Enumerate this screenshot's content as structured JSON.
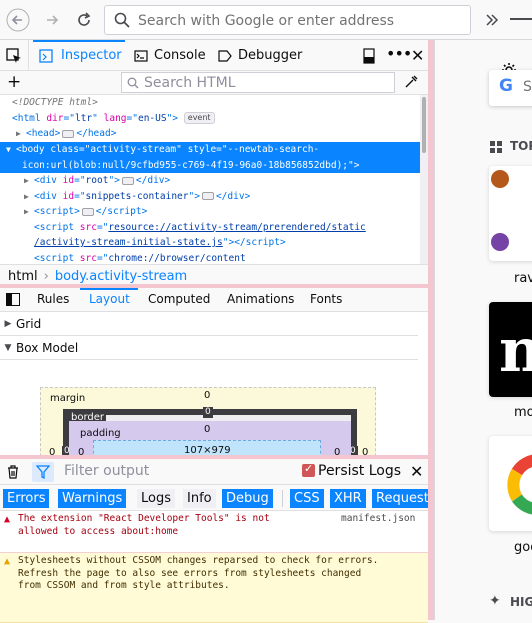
{
  "browser": {
    "url_placeholder": "Search with Google or enter address"
  },
  "devtools": {
    "tabs": [
      {
        "label": "Inspector",
        "selected": true
      },
      {
        "label": "Console",
        "selected": false
      },
      {
        "label": "Debugger",
        "selected": false
      }
    ],
    "search_html_placeholder": "Search HTML",
    "markup": {
      "doctype": "<!DOCTYPE html>",
      "html_open": {
        "tag": "html",
        "attrs": [
          {
            "name": "dir",
            "value": "ltr"
          },
          {
            "name": "lang",
            "value": "en-US"
          }
        ],
        "badge": "event"
      },
      "head": {
        "tag": "head"
      },
      "body_open_line1": "<body class=\"activity-stream\" style=\"--newtab-search-",
      "body_open_line2": "icon:url(blob:null/9cfbd955-c769-4f19-96a0-18b856852dbd);\">",
      "div_root": {
        "tag": "div",
        "id": "root"
      },
      "div_snippets": {
        "tag": "div",
        "id": "snippets-container"
      },
      "script_empty": {
        "tag": "script"
      },
      "script_src_line1_attr": "src=",
      "script_src_line1_val": "resource://activity-stream/prerendered/static",
      "script_src_line2_val": "/activity-stream-initial-state.js",
      "script_chrome_val": "chrome://browser/content"
    },
    "breadcrumbs": [
      {
        "label": "html",
        "selected": false
      },
      {
        "label": "body.activity-stream",
        "selected": true
      }
    ],
    "rules_tabs": [
      {
        "label": "Rules",
        "selected": false
      },
      {
        "label": "Layout",
        "selected": true
      },
      {
        "label": "Computed",
        "selected": false
      },
      {
        "label": "Animations",
        "selected": false
      },
      {
        "label": "Fonts",
        "selected": false
      }
    ],
    "sections": {
      "grid": "Grid",
      "box_model": "Box Model"
    },
    "box_model": {
      "margin_label": "margin",
      "border_label": "border",
      "padding_label": "padding",
      "margin_top": "0",
      "border_top": "0",
      "padding_top": "0",
      "margin_left": "0",
      "border_left": "0",
      "padding_left": "0",
      "margin_right": "0",
      "border_right": "0",
      "padding_right": "0",
      "content_size": "107×979"
    },
    "console": {
      "filter_placeholder": "Filter output",
      "persist_logs_label": "Persist Logs",
      "persist_logs_checked": true,
      "filters": [
        {
          "label": "Errors",
          "on": true
        },
        {
          "label": "Warnings",
          "on": true
        },
        {
          "label": "Logs",
          "on": false
        },
        {
          "label": "Info",
          "on": false
        },
        {
          "label": "Debug",
          "on": true
        },
        {
          "label": "CSS",
          "on": true
        },
        {
          "label": "XHR",
          "on": true
        },
        {
          "label": "Requests",
          "on": true
        }
      ],
      "messages": [
        {
          "level": "error",
          "text": "The extension \"React Developer Tools\" is not\nallowed to access about:home",
          "source": "manifest.json"
        },
        {
          "level": "warning",
          "text": "Stylesheets without CSSOM changes reparsed to check for errors.\nRefresh the page to also see errors from stylesheets changed\nfrom CSSOM and from style attributes."
        }
      ]
    }
  },
  "page": {
    "search_partial": "S",
    "top_sites_heading_partial": "TOP",
    "tiles": [
      {
        "label": "rav"
      },
      {
        "label": "mo"
      },
      {
        "label": "goo"
      }
    ],
    "highlights_heading_partial": "HIG"
  },
  "colors": {
    "accent": "#0a84ff",
    "selected_row": "#0a84ff",
    "splitter": "#f4c6cf",
    "error_text": "#a4000f",
    "warning_bg": "#fffbd6"
  }
}
